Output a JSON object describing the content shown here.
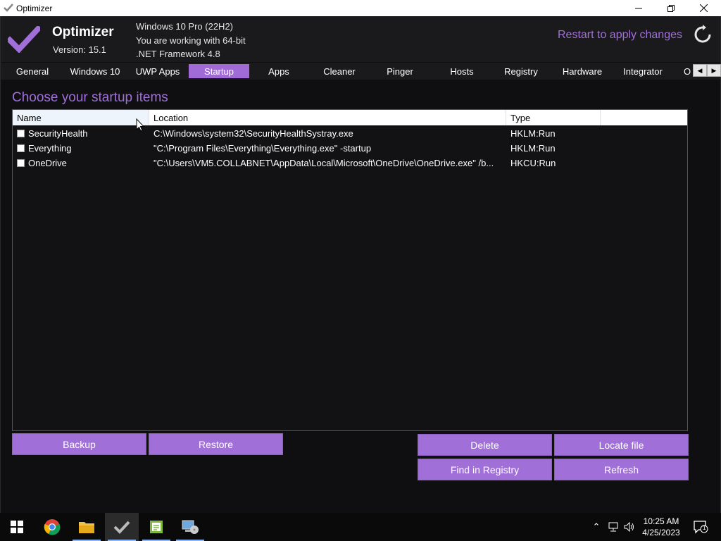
{
  "window": {
    "title": "Optimizer"
  },
  "header": {
    "app_name": "Optimizer",
    "version": "Version: 15.1",
    "sysinfo": [
      "Windows 10 Pro (22H2)",
      "You are working with 64-bit",
      ".NET Framework 4.8"
    ],
    "restart_label": "Restart to apply changes"
  },
  "tabs": [
    {
      "label": "General"
    },
    {
      "label": "Windows 10"
    },
    {
      "label": "UWP Apps"
    },
    {
      "label": "Startup",
      "active": true
    },
    {
      "label": "Apps"
    },
    {
      "label": "Cleaner"
    },
    {
      "label": "Pinger"
    },
    {
      "label": "Hosts"
    },
    {
      "label": "Registry"
    },
    {
      "label": "Hardware"
    },
    {
      "label": "Integrator"
    },
    {
      "label": "O"
    }
  ],
  "startup": {
    "section_title": "Choose your startup items",
    "columns": [
      "Name",
      "Location",
      "Type"
    ],
    "rows": [
      {
        "name": "SecurityHealth",
        "location": "C:\\Windows\\system32\\SecurityHealthSystray.exe",
        "type": "HKLM:Run",
        "checked": false
      },
      {
        "name": "Everything",
        "location": "\"C:\\Program Files\\Everything\\Everything.exe\" -startup",
        "type": "HKLM:Run",
        "checked": false
      },
      {
        "name": "OneDrive",
        "location": "\"C:\\Users\\VM5.COLLABNET\\AppData\\Local\\Microsoft\\OneDrive\\OneDrive.exe\" /b...",
        "type": "HKCU:Run",
        "checked": false
      }
    ]
  },
  "buttons": {
    "backup": "Backup",
    "restore": "Restore",
    "delete": "Delete",
    "locate_file": "Locate file",
    "find_in_registry": "Find in Registry",
    "refresh": "Refresh"
  },
  "taskbar": {
    "time": "10:25 AM",
    "date": "4/25/2023",
    "notification_count": "1"
  },
  "colors": {
    "accent": "#a070d8",
    "background": "#0f0e10"
  }
}
